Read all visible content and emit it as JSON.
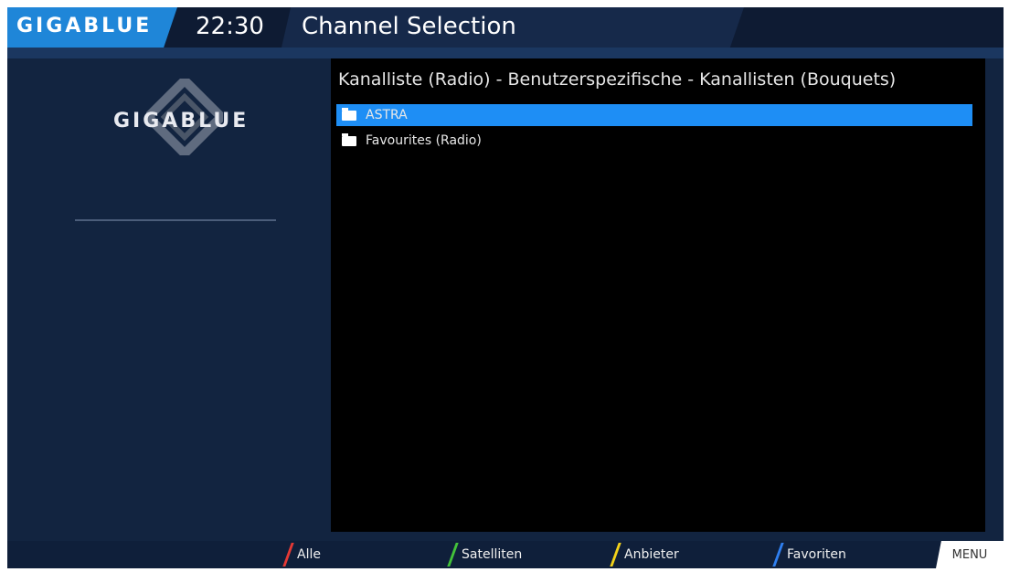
{
  "header": {
    "brand": "GIGABLUE",
    "clock": "22:30",
    "title": "Channel Selection"
  },
  "sidebar": {
    "brand": "GIGABLUE",
    "logo_icon": "gigablue-diamond-logo"
  },
  "list": {
    "header": "Kanalliste (Radio) - Benutzerspezifische - Kanallisten (Bouquets)",
    "items": [
      {
        "label": "ASTRA",
        "icon": "folder-icon",
        "selected": true
      },
      {
        "label": "Favourites (Radio)",
        "icon": "folder-icon",
        "selected": false
      }
    ]
  },
  "footer": {
    "keys": [
      {
        "label": "Alle",
        "color": "#e53935"
      },
      {
        "label": "Satelliten",
        "color": "#43c23a"
      },
      {
        "label": "Anbieter",
        "color": "#f3d21a"
      },
      {
        "label": "Favoriten",
        "color": "#2f7ff0"
      }
    ],
    "menu": "MENU"
  },
  "colors": {
    "accent": "#1f86d8",
    "selection": "#1e8ef5",
    "background": "#122440",
    "list_background": "#000000"
  }
}
